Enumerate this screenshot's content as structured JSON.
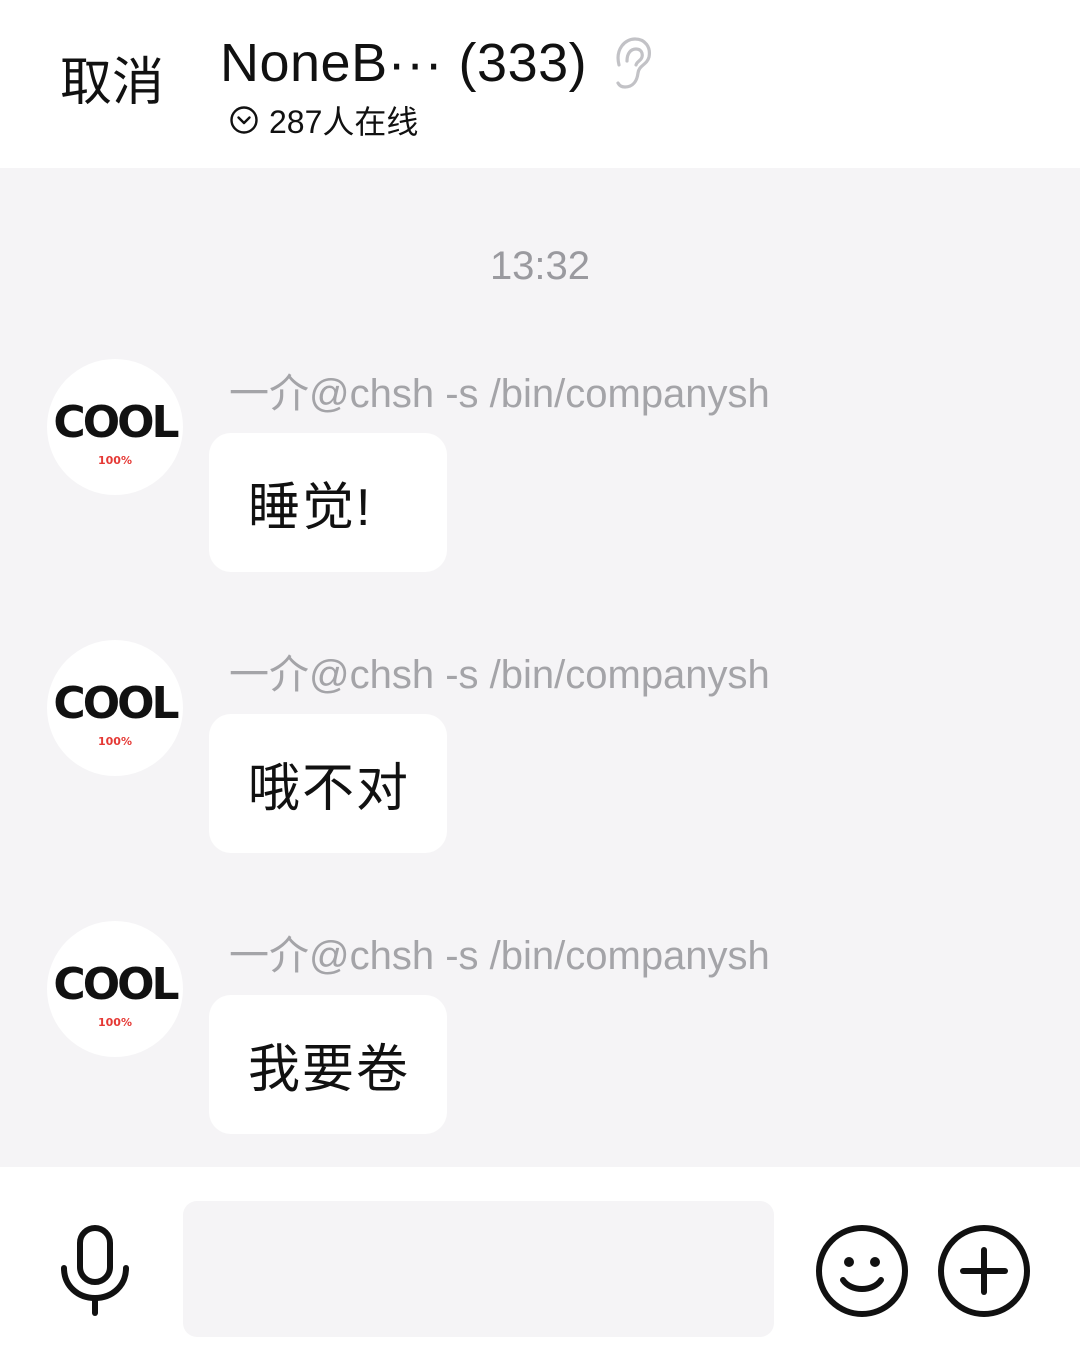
{
  "header": {
    "cancel_label": "取消",
    "title": "NoneB··· (333)",
    "online_text": "287人在线"
  },
  "chat": {
    "timestamp": "13:32",
    "messages": [
      {
        "sender": "一介@chsh -s /bin/companysh",
        "avatar_text": "COOL",
        "avatar_subtext": "100%",
        "text": "睡觉!"
      },
      {
        "sender": "一介@chsh -s /bin/companysh",
        "avatar_text": "COOL",
        "avatar_subtext": "100%",
        "text": "哦不对"
      },
      {
        "sender": "一介@chsh -s /bin/companysh",
        "avatar_text": "COOL",
        "avatar_subtext": "100%",
        "text": "我要卷"
      }
    ]
  },
  "input_bar": {
    "placeholder": "",
    "icons": [
      "microphone-icon",
      "emoji-icon",
      "plus-icon"
    ]
  },
  "colors": {
    "chat_background": "#f5f4f6",
    "bubble_background": "#ffffff",
    "sender_text": "#a4a4a8",
    "timestamp_text": "#9a9a9f",
    "avatar_subtext": "#e53935"
  }
}
